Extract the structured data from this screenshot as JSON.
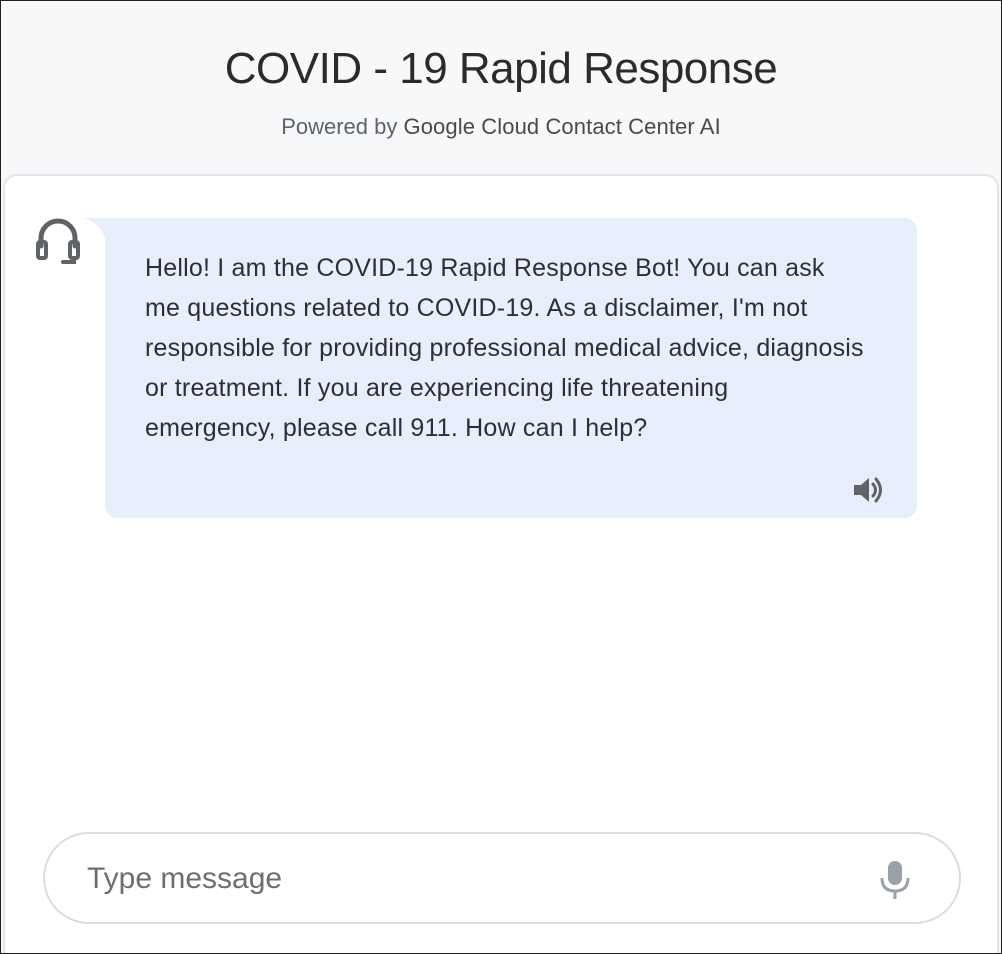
{
  "header": {
    "title": "COVID - 19 Rapid Response",
    "powered_by": "Powered by",
    "brand": "Google Cloud Contact Center AI"
  },
  "messages": [
    {
      "sender": "agent",
      "icon": "headset-icon",
      "text": "Hello! I am the COVID-19 Rapid Response Bot! You can ask me questions related to COVID-19. As a disclaimer, I'm not responsible for providing professional medical advice, diagnosis or treatment. If you are experiencing life threatening emergency, please call 911. How can I help?",
      "action_icon": "speaker-icon"
    }
  ],
  "composer": {
    "placeholder": "Type message",
    "value": "",
    "mic_icon": "microphone-icon"
  },
  "colors": {
    "header_bg": "#f7f8fa",
    "bubble_bg": "#e8eefb",
    "text": "#2c2f33",
    "icon": "#5f6368"
  }
}
